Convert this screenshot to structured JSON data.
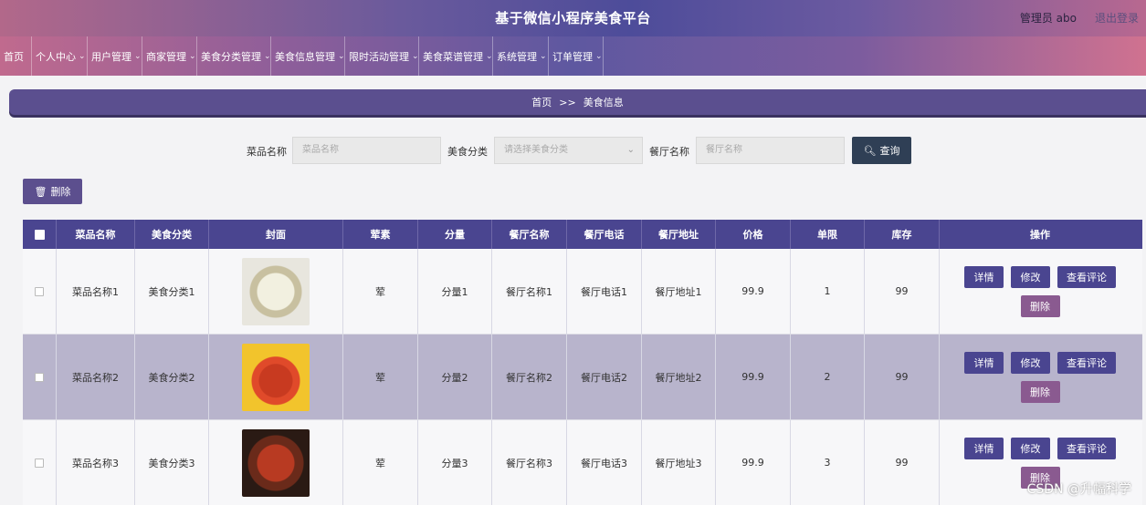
{
  "header": {
    "title": "基于微信小程序美食平台",
    "admin": "管理员 abo",
    "logout": "退出登录"
  },
  "nav": [
    {
      "label": "首页",
      "dropdown": false
    },
    {
      "label": "个人中心",
      "dropdown": true
    },
    {
      "label": "用户管理",
      "dropdown": true
    },
    {
      "label": "商家管理",
      "dropdown": true
    },
    {
      "label": "美食分类管理",
      "dropdown": true
    },
    {
      "label": "美食信息管理",
      "dropdown": true
    },
    {
      "label": "限时活动管理",
      "dropdown": true
    },
    {
      "label": "美食菜谱管理",
      "dropdown": true
    },
    {
      "label": "系统管理",
      "dropdown": true
    },
    {
      "label": "订单管理",
      "dropdown": true
    }
  ],
  "breadcrumb": {
    "home": "首页",
    "sep": ">>",
    "current": "美食信息"
  },
  "search": {
    "name_label": "菜品名称",
    "name_placeholder": "菜品名称",
    "category_label": "美食分类",
    "category_placeholder": "请选择美食分类",
    "restaurant_label": "餐厅名称",
    "restaurant_placeholder": "餐厅名称",
    "button_label": "查询"
  },
  "toolbar": {
    "delete_label": "删除"
  },
  "table": {
    "headers": [
      "菜品名称",
      "美食分类",
      "封面",
      "荤素",
      "分量",
      "餐厅名称",
      "餐厅电话",
      "餐厅地址",
      "价格",
      "单限",
      "库存",
      "操作"
    ],
    "rows": [
      {
        "name": "菜品名称1",
        "category": "美食分类1",
        "meat": "荤",
        "portion": "分量1",
        "restaurant": "餐厅名称1",
        "phone": "餐厅电话1",
        "address": "餐厅地址1",
        "price": "99.9",
        "limit": "1",
        "stock": "99"
      },
      {
        "name": "菜品名称2",
        "category": "美食分类2",
        "meat": "荤",
        "portion": "分量2",
        "restaurant": "餐厅名称2",
        "phone": "餐厅电话2",
        "address": "餐厅地址2",
        "price": "99.9",
        "limit": "2",
        "stock": "99"
      },
      {
        "name": "菜品名称3",
        "category": "美食分类3",
        "meat": "荤",
        "portion": "分量3",
        "restaurant": "餐厅名称3",
        "phone": "餐厅电话3",
        "address": "餐厅地址3",
        "price": "99.9",
        "limit": "3",
        "stock": "99"
      }
    ],
    "actions": {
      "detail": "详情",
      "edit": "修改",
      "review": "查看评论",
      "delete": "删除"
    }
  },
  "watermark": "CSDN @升幅科学",
  "colors": {
    "primary": "#4a4590",
    "delete_button": "#8a5a90",
    "search_button": "#2f3f55"
  }
}
